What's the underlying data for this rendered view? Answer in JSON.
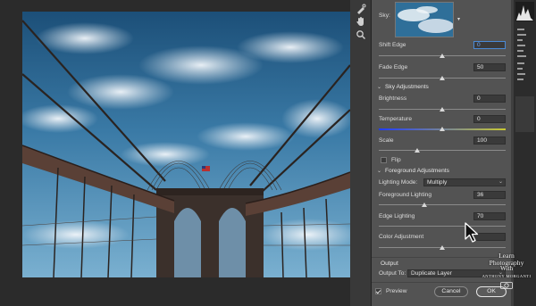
{
  "panel": {
    "sky_label": "Sky:",
    "shift_edge": {
      "label": "Shift Edge",
      "value": "0",
      "slider": 0.5
    },
    "fade_edge": {
      "label": "Fade Edge",
      "value": "50",
      "slider": 0.5
    },
    "sky_adjustments": {
      "title": "Sky Adjustments",
      "brightness": {
        "label": "Brightness",
        "value": "0",
        "slider": 0.5
      },
      "temperature": {
        "label": "Temperature",
        "value": "0",
        "slider": 0.5
      },
      "scale": {
        "label": "Scale",
        "value": "100",
        "slider": 0.3
      },
      "flip_label": "Flip"
    },
    "foreground_adjustments": {
      "title": "Foreground Adjustments",
      "lighting_mode_label": "Lighting Mode:",
      "lighting_mode_value": "Multiply",
      "foreground_lighting": {
        "label": "Foreground Lighting",
        "value": "36",
        "slider": 0.36
      },
      "edge_lighting": {
        "label": "Edge Lighting",
        "value": "70",
        "slider": 0.7
      },
      "color_adjustment": {
        "label": "Color Adjustment",
        "value": "",
        "slider": 0.5
      }
    },
    "output": {
      "title": "Output",
      "output_to_label": "Output To:",
      "output_to_value": "Duplicate Layer"
    },
    "preview_label": "Preview",
    "cancel_label": "Cancel",
    "ok_label": "OK"
  },
  "watermark": {
    "line1": "Learn",
    "line2": "Photography",
    "line3": "With",
    "line4": "ANTHONY MORGANTI"
  },
  "colors": {
    "panel_bg": "#535353",
    "canvas_bg": "#2b2b2b",
    "accent": "#4a8ad6"
  }
}
